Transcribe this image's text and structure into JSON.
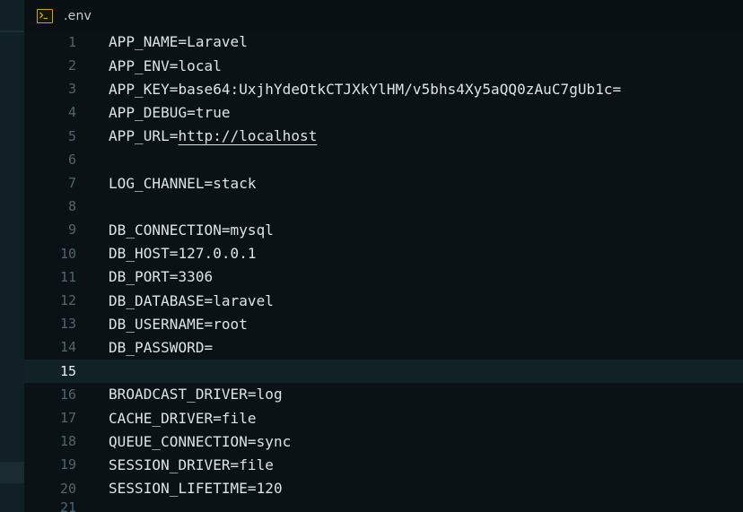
{
  "tab": {
    "icon": "terminal-icon",
    "filename": ".env",
    "icon_color": "#d8a300"
  },
  "editor": {
    "current_line": "15",
    "lines": [
      {
        "num": "1",
        "text": "APP_NAME=Laravel"
      },
      {
        "num": "2",
        "text": "APP_ENV=local"
      },
      {
        "num": "3",
        "text": "APP_KEY=base64:UxjhYdeOtkCTJXkYlHM/v5bhs4Xy5aQQ0zAuC7gUb1c="
      },
      {
        "num": "4",
        "text": "APP_DEBUG=true"
      },
      {
        "num": "5",
        "text": "APP_URL=",
        "link": "http://localhost"
      },
      {
        "num": "6",
        "text": ""
      },
      {
        "num": "7",
        "text": "LOG_CHANNEL=stack"
      },
      {
        "num": "8",
        "text": ""
      },
      {
        "num": "9",
        "text": "DB_CONNECTION=mysql"
      },
      {
        "num": "10",
        "text": "DB_HOST=127.0.0.1"
      },
      {
        "num": "11",
        "text": "DB_PORT=3306"
      },
      {
        "num": "12",
        "text": "DB_DATABASE=laravel"
      },
      {
        "num": "13",
        "text": "DB_USERNAME=root"
      },
      {
        "num": "14",
        "text": "DB_PASSWORD="
      },
      {
        "num": "15",
        "text": ""
      },
      {
        "num": "16",
        "text": "BROADCAST_DRIVER=log"
      },
      {
        "num": "17",
        "text": "CACHE_DRIVER=file"
      },
      {
        "num": "18",
        "text": "QUEUE_CONNECTION=sync"
      },
      {
        "num": "19",
        "text": "SESSION_DRIVER=file"
      },
      {
        "num": "20",
        "text": "SESSION_LIFETIME=120"
      },
      {
        "num": "21",
        "text": ""
      }
    ]
  }
}
